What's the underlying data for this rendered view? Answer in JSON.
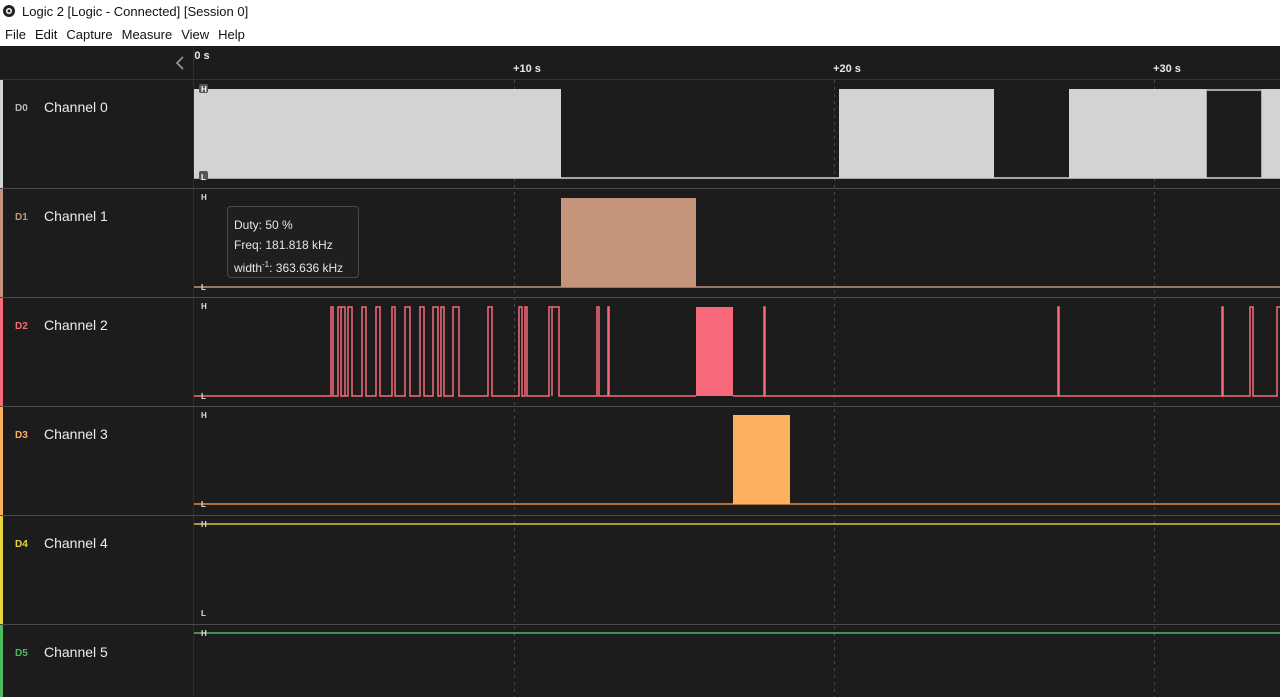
{
  "window": {
    "title": "Logic 2 [Logic - Connected] [Session 0]"
  },
  "menu": [
    "File",
    "Edit",
    "Capture",
    "Measure",
    "View",
    "Help"
  ],
  "timeline": {
    "labels": [
      "0 s",
      "+10 s",
      "+20 s",
      "+30 s"
    ]
  },
  "level_labels": {
    "high": "H",
    "low": "L"
  },
  "channels": [
    {
      "id": "D0",
      "name": "Channel 0",
      "color": "#d3d3d3"
    },
    {
      "id": "D1",
      "name": "Channel 1",
      "color": "#c4957a"
    },
    {
      "id": "D2",
      "name": "Channel 2",
      "color": "#f86a7b"
    },
    {
      "id": "D3",
      "name": "Channel 3",
      "color": "#fdb05d"
    },
    {
      "id": "D4",
      "name": "Channel 4",
      "color": "#e6d53f"
    },
    {
      "id": "D5",
      "name": "Channel 5",
      "color": "#4fba5b"
    }
  ],
  "tooltip": {
    "duty": "Duty: 50 %",
    "freq": "Freq: 181.818 kHz",
    "width_prefix": "width",
    "width_sup": "-1",
    "width_value": ": 363.636 kHz"
  }
}
